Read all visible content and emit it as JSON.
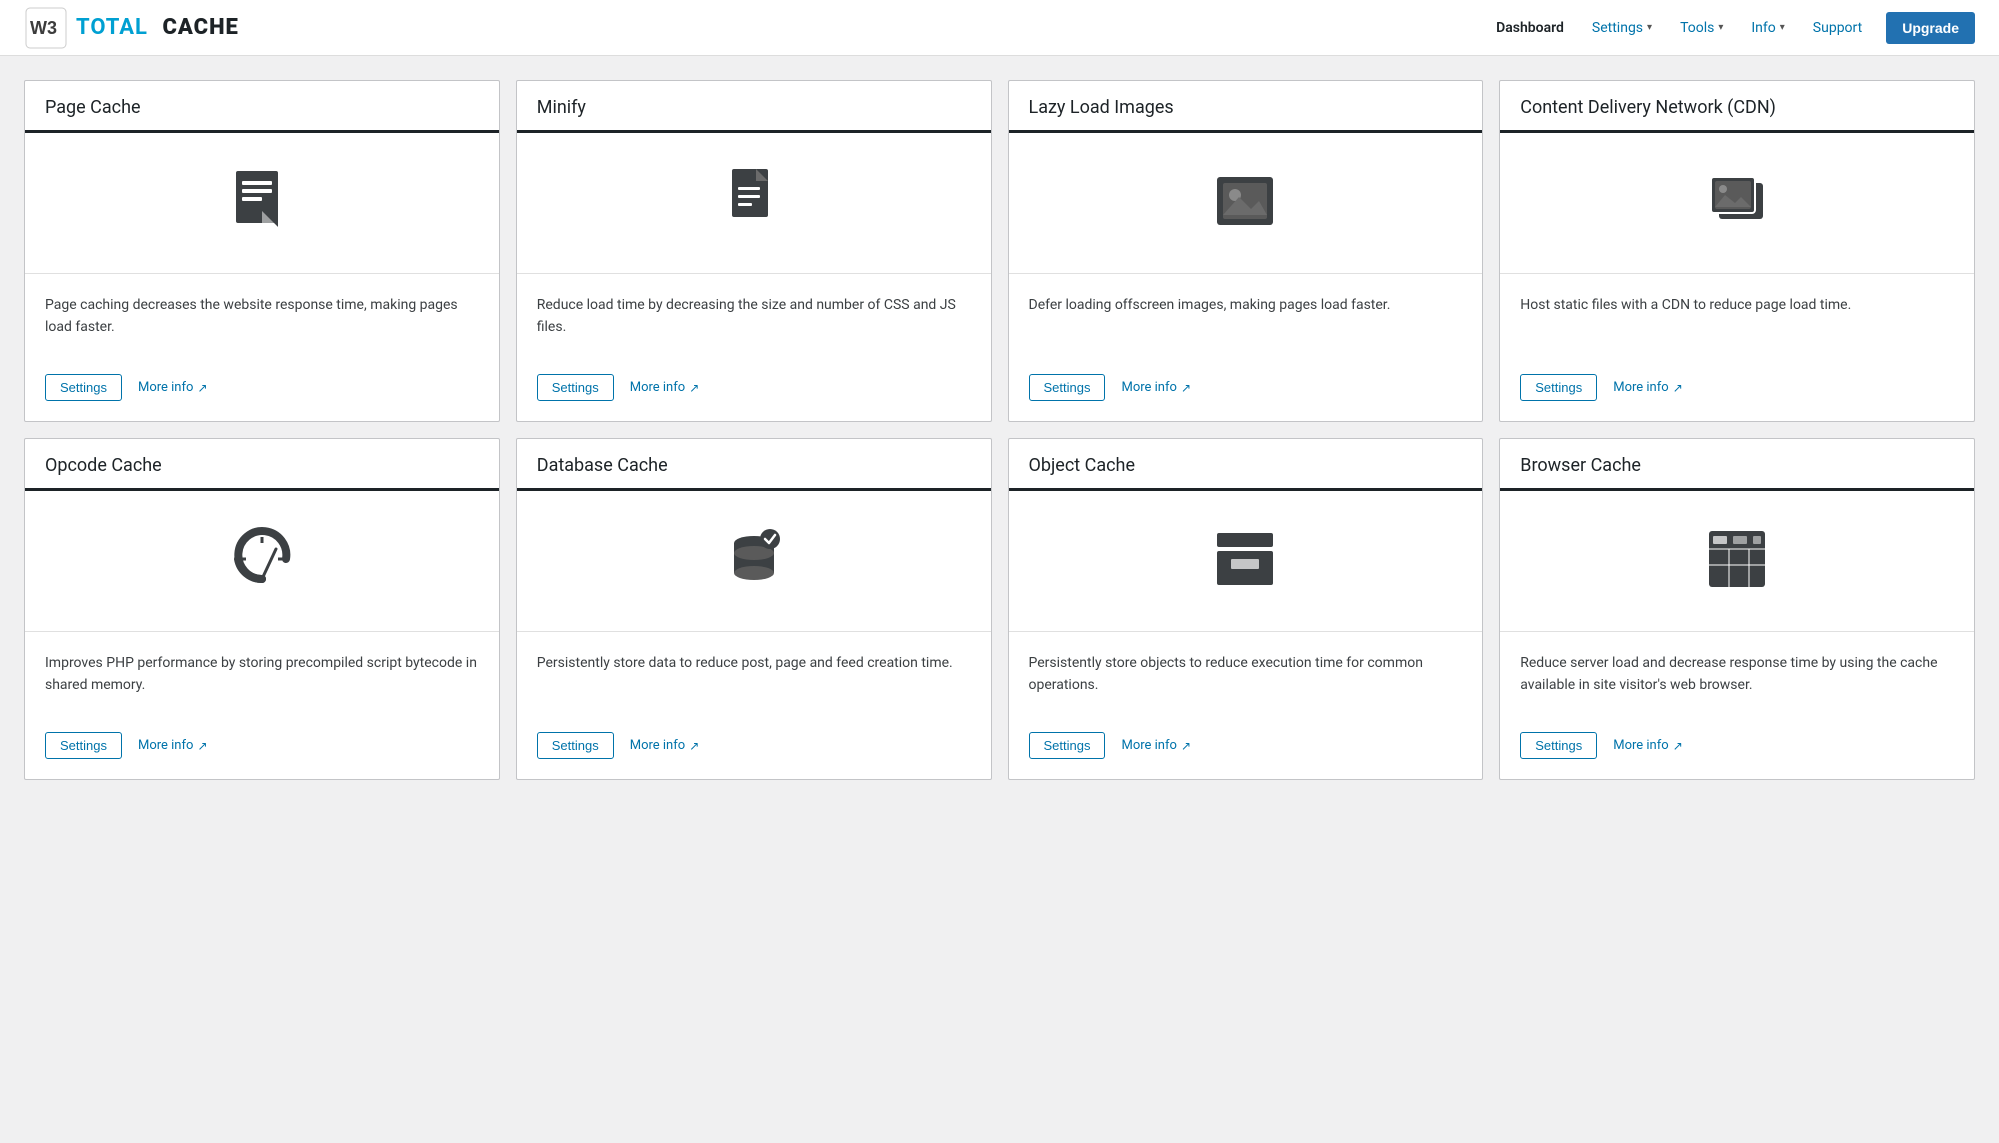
{
  "header": {
    "logo_text_w3": "W3",
    "logo_text_total": "TOTAL",
    "logo_text_cache": "CACHE",
    "nav": [
      {
        "label": "Dashboard",
        "hasDropdown": false,
        "active": true
      },
      {
        "label": "Settings",
        "hasDropdown": true,
        "active": false
      },
      {
        "label": "Tools",
        "hasDropdown": true,
        "active": false
      },
      {
        "label": "Info",
        "hasDropdown": true,
        "active": false
      },
      {
        "label": "Support",
        "hasDropdown": false,
        "active": false
      }
    ],
    "upgrade_label": "Upgrade"
  },
  "cards": [
    {
      "id": "page-cache",
      "title": "Page Cache",
      "description": "Page caching decreases the website response time, making pages load faster.",
      "icon": "page-cache",
      "settings_label": "Settings",
      "more_info_label": "More info"
    },
    {
      "id": "minify",
      "title": "Minify",
      "description": "Reduce load time by decreasing the size and number of CSS and JS files.",
      "icon": "minify",
      "settings_label": "Settings",
      "more_info_label": "More info"
    },
    {
      "id": "lazy-load",
      "title": "Lazy Load Images",
      "description": "Defer loading offscreen images, making pages load faster.",
      "icon": "lazy-load",
      "settings_label": "Settings",
      "more_info_label": "More info"
    },
    {
      "id": "cdn",
      "title": "Content Delivery Network (CDN)",
      "description": "Host static files with a CDN to reduce page load time.",
      "icon": "cdn",
      "settings_label": "Settings",
      "more_info_label": "More info"
    },
    {
      "id": "opcode-cache",
      "title": "Opcode Cache",
      "description": "Improves PHP performance by storing precompiled script bytecode in shared memory.",
      "icon": "opcode",
      "settings_label": "Settings",
      "more_info_label": "More info"
    },
    {
      "id": "database-cache",
      "title": "Database Cache",
      "description": "Persistently store data to reduce post, page and feed creation time.",
      "icon": "database",
      "settings_label": "Settings",
      "more_info_label": "More info"
    },
    {
      "id": "object-cache",
      "title": "Object Cache",
      "description": "Persistently store objects to reduce execution time for common operations.",
      "icon": "object",
      "settings_label": "Settings",
      "more_info_label": "More info"
    },
    {
      "id": "browser-cache",
      "title": "Browser Cache",
      "description": "Reduce server load and decrease response time by using the cache available in site visitor's web browser.",
      "icon": "browser",
      "settings_label": "Settings",
      "more_info_label": "More info"
    }
  ]
}
